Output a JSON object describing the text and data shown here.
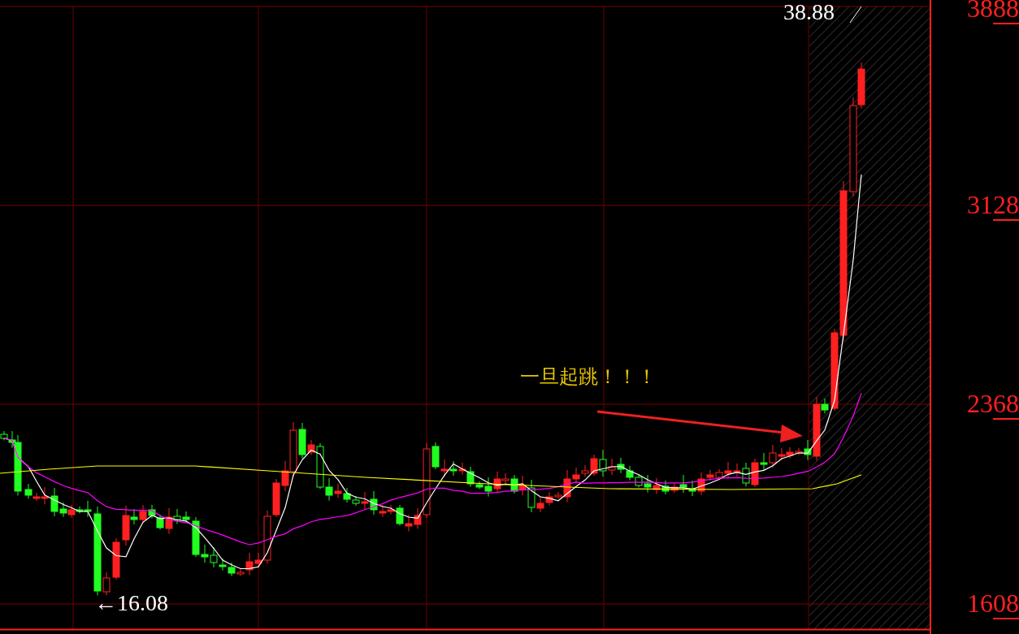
{
  "price_labels": [
    {
      "kind": "high",
      "text": "38.88"
    },
    {
      "kind": "low",
      "text": "←16.08"
    }
  ],
  "annotation": "一旦起跳！！！",
  "y_axis": {
    "labels": [
      "3888",
      "3128",
      "2368",
      "1608"
    ]
  }
}
